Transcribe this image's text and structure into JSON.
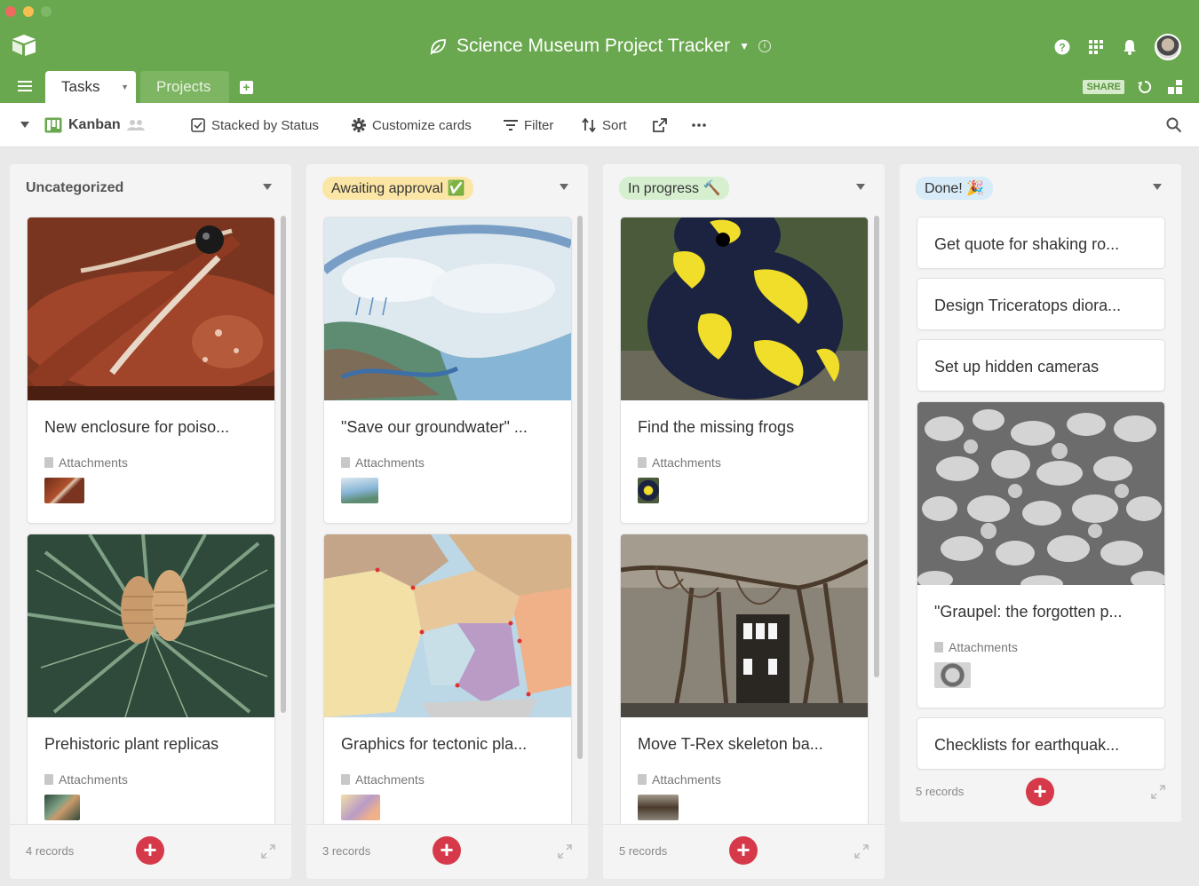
{
  "app": {
    "base_title": "Science Museum Project Tracker",
    "tabs": [
      {
        "label": "Tasks"
      },
      {
        "label": "Projects"
      }
    ],
    "share_label": "SHARE"
  },
  "toolbar": {
    "view_name": "Kanban",
    "stacked": "Stacked by Status",
    "customize": "Customize cards",
    "filter": "Filter",
    "sort": "Sort"
  },
  "columns": [
    {
      "label": "Uncategorized",
      "count": "4 records",
      "cards": [
        {
          "title": "New enclosure for poiso...",
          "attachments_label": "Attachments"
        },
        {
          "title": "Prehistoric plant replicas",
          "attachments_label": "Attachments"
        }
      ]
    },
    {
      "label": "Awaiting approval ✅",
      "count": "3 records",
      "cards": [
        {
          "title": "\"Save our groundwater\" ...",
          "attachments_label": "Attachments"
        },
        {
          "title": "Graphics for tectonic pla...",
          "attachments_label": "Attachments"
        }
      ]
    },
    {
      "label": "In progress 🔨",
      "count": "5 records",
      "cards": [
        {
          "title": "Find the missing frogs",
          "attachments_label": "Attachments"
        },
        {
          "title": "Move T-Rex skeleton ba...",
          "attachments_label": "Attachments"
        }
      ]
    },
    {
      "label": "Done! 🎉",
      "count": "5 records",
      "simple_cards": [
        {
          "title": "Get quote for shaking ro..."
        },
        {
          "title": "Design Triceratops diora..."
        },
        {
          "title": "Set up hidden cameras"
        }
      ],
      "image_card": {
        "title": "\"Graupel: the forgotten p...",
        "attachments_label": "Attachments"
      },
      "last_card": {
        "title": "Checklists for earthquak..."
      }
    }
  ],
  "colors": {
    "header_green": "#6aa84f",
    "awaiting_pill": "#fbe6a6",
    "progress_pill": "#d5efcf",
    "done_pill": "#d7ebf8",
    "add_button": "#d63a4a"
  },
  "icons": [
    "airtable-logo-icon",
    "leaf-icon",
    "info-icon",
    "help-icon",
    "apps-grid-icon",
    "bell-icon",
    "avatar",
    "hamburger-icon",
    "add-table-icon",
    "history-icon",
    "blocks-icon",
    "collapse-caret-icon",
    "kanban-icon",
    "collaborators-icon",
    "checkbox-icon",
    "gear-icon",
    "filter-icon",
    "sort-icon",
    "share-view-icon",
    "more-icon",
    "search-icon",
    "add-record-icon",
    "expand-icon",
    "attachment-file-icon"
  ]
}
